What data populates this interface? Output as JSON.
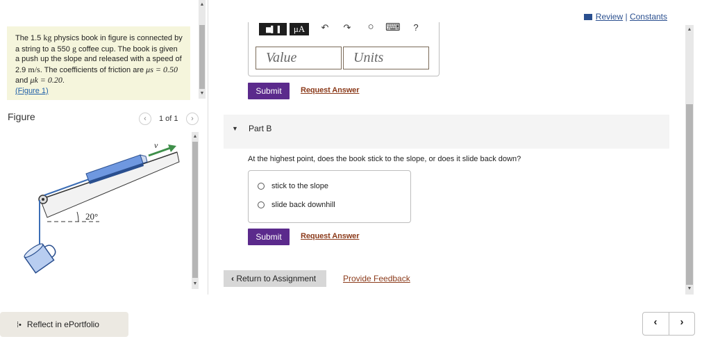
{
  "problem": {
    "p1": "The 1.5",
    "unit_kg": "kg",
    "p2": "physics book in figure is connected by a string to a 550",
    "unit_g": "g",
    "p3": "coffee cup. The book is given a push up the slope and released with a speed of 2.9",
    "unit_ms": "m/s",
    "p4": ". The coefficients of friction are",
    "mu_s": "μs = 0.50",
    "and": "and",
    "mu_k": "μk = 0.20",
    "period": ".",
    "figure_link": "(Figure 1)"
  },
  "figure_panel": {
    "label": "Figure",
    "pager_count": "1 of 1",
    "prev_glyph": "‹",
    "next_glyph": "›",
    "angle": "20°",
    "velocity_symbol": "v⃗"
  },
  "reflect": {
    "glyph": "⁞•",
    "label": "Reflect in ePortfolio"
  },
  "header": {
    "review": "Review",
    "separator": "|",
    "constants": "Constants"
  },
  "toolbar": {
    "matrix_icon": "▆▌▐",
    "mu_a": "μA",
    "undo": "↶",
    "redo": "↷",
    "reset": "○",
    "keyboard": "⌨",
    "help": "?"
  },
  "part_a": {
    "value_placeholder": "Value",
    "units_placeholder": "Units",
    "submit_label": "Submit",
    "request_label": "Request Answer"
  },
  "part_b": {
    "caret": "▼",
    "title": "Part B",
    "question": "At the highest point, does the book stick to the slope, or does it slide back down?",
    "choices": [
      "stick to the slope",
      "slide back downhill"
    ],
    "submit_label": "Submit",
    "request_label": "Request Answer"
  },
  "footer": {
    "return_label": "Return to Assignment",
    "return_glyph": "‹",
    "feedback_label": "Provide Feedback",
    "prev_glyph": "‹",
    "next_glyph": "›"
  },
  "colors": {
    "problem_bg": "#f5f5dc",
    "submit": "#5b2a8c",
    "link_brown": "#8b3a1a",
    "link_blue": "#2a4f8f",
    "arrow_green": "#3f8f4a",
    "book_blue": "#6f98e0"
  }
}
